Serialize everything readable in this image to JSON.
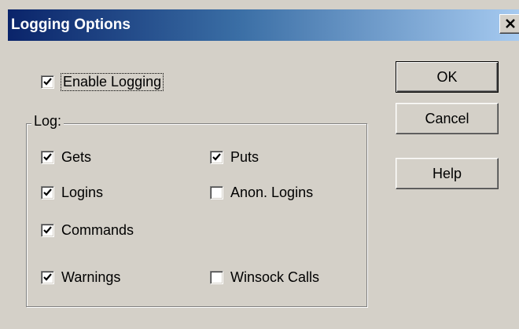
{
  "window": {
    "title": "Logging Options"
  },
  "enable_logging": {
    "label": "Enable Logging",
    "checked": true
  },
  "log_group": {
    "legend": "Log:",
    "options": [
      {
        "label": "Gets",
        "checked": true
      },
      {
        "label": "Puts",
        "checked": true
      },
      {
        "label": "Logins",
        "checked": true
      },
      {
        "label": "Anon. Logins",
        "checked": false
      },
      {
        "label": "Commands",
        "checked": true
      },
      {
        "label": "Warnings",
        "checked": true
      },
      {
        "label": "Winsock Calls",
        "checked": false
      }
    ]
  },
  "buttons": {
    "ok": "OK",
    "cancel": "Cancel",
    "help": "Help"
  },
  "icons": {
    "close": "close-icon",
    "check": "checkmark-icon"
  },
  "colors": {
    "title_start": "#0a246a",
    "title_end": "#a6caf0",
    "face": "#d4d0c8"
  }
}
